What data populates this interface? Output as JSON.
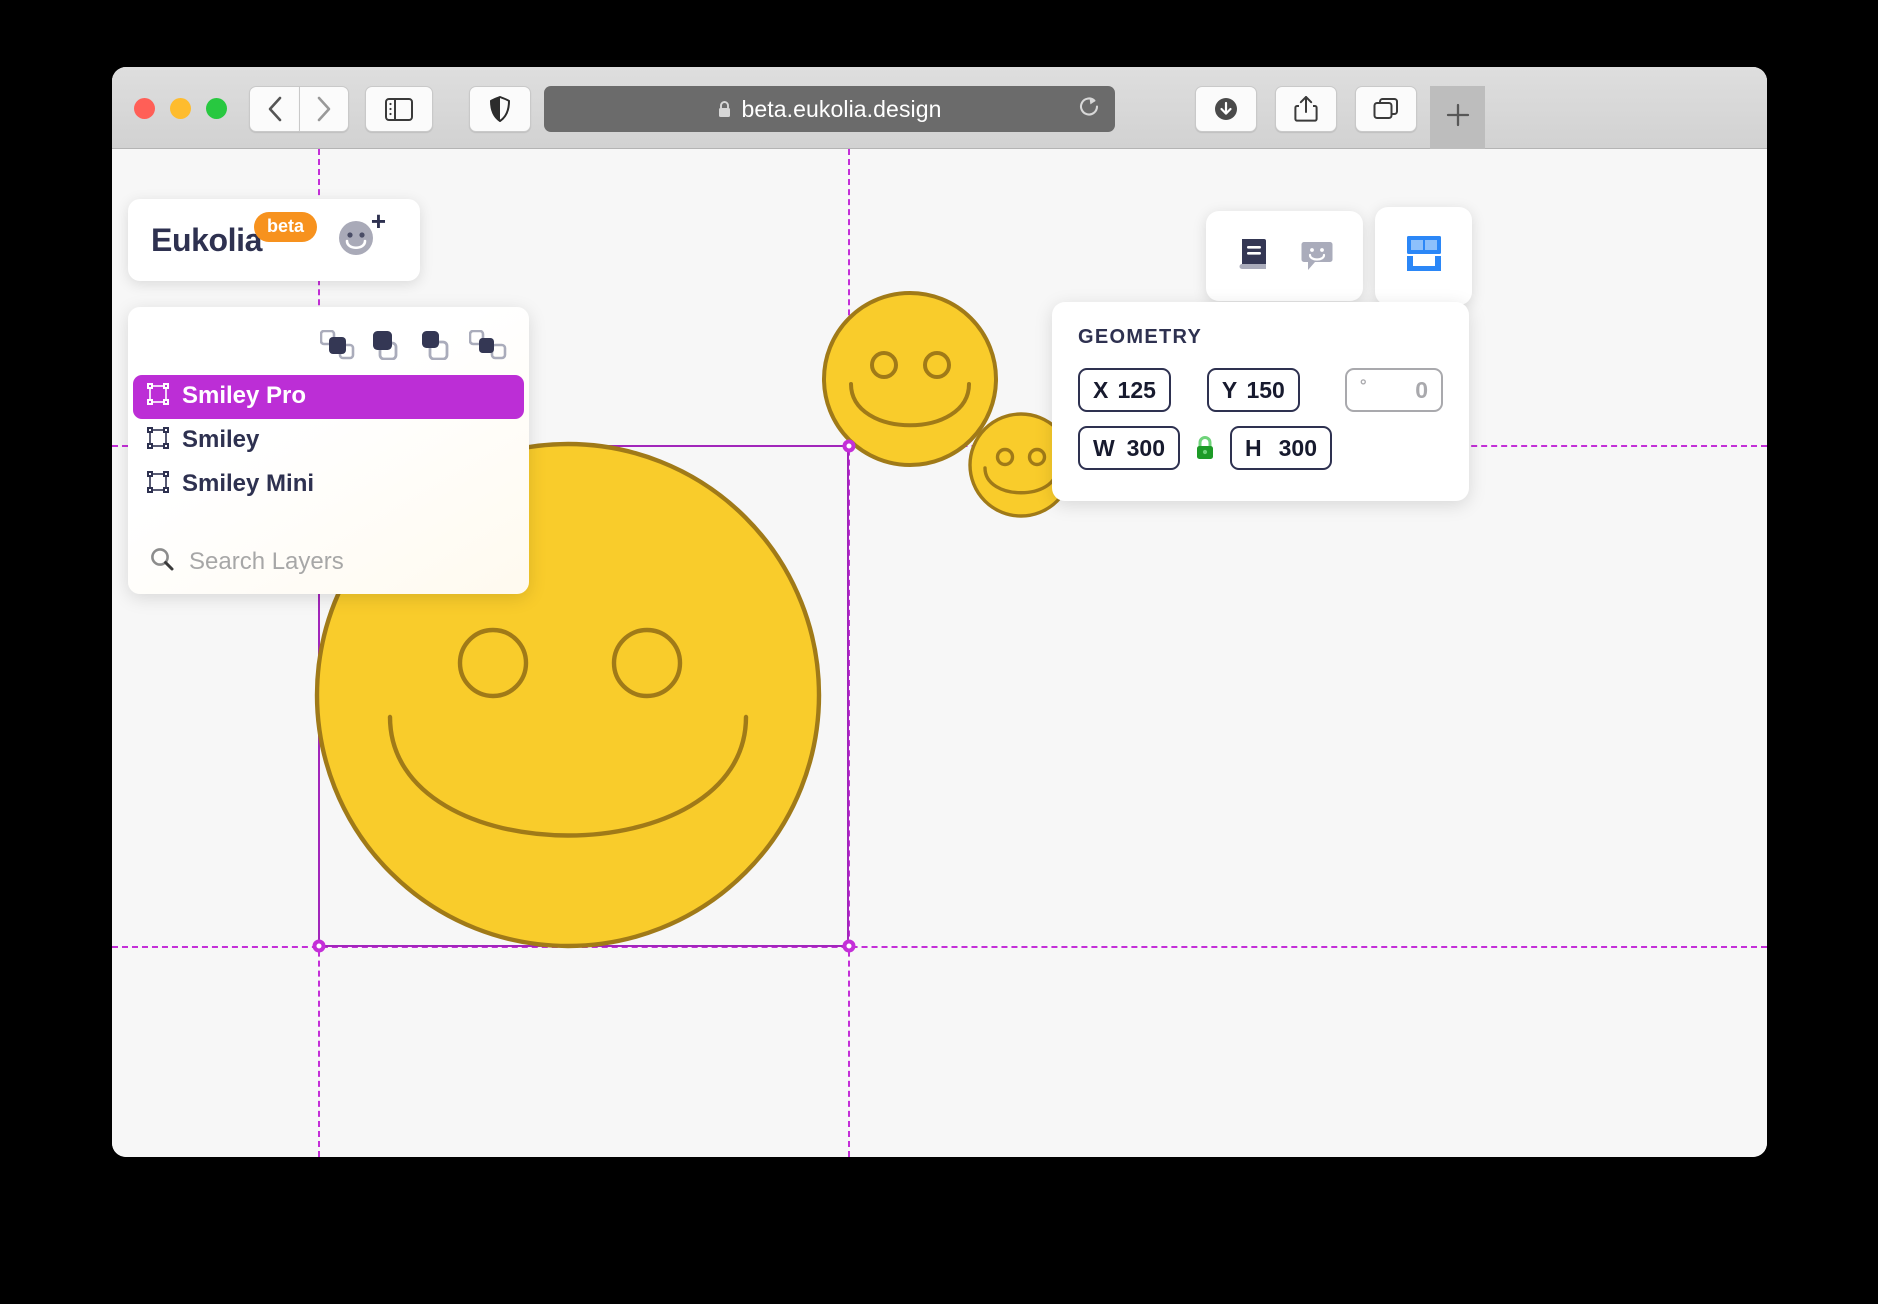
{
  "browser": {
    "address": "beta.eukolia.design",
    "lock_icon": "lock-icon",
    "reload_icon": "reload-icon",
    "back_icon": "chevron-left-icon",
    "forward_icon": "chevron-right-icon",
    "sidebar_icon": "sidebar-icon",
    "shield_icon": "shield-icon",
    "download_icon": "download-icon",
    "share_icon": "share-icon",
    "tabs_icon": "tab-overview-icon",
    "newtab_label": "+"
  },
  "app": {
    "logo_text": "Eukolia",
    "beta_badge": "beta",
    "avatar_icon": "smiley-avatar-icon",
    "avatar_plus": "+"
  },
  "layers_panel": {
    "arrange_buttons": [
      {
        "name": "send-to-back-button",
        "icon": "send-to-back-icon"
      },
      {
        "name": "bring-to-front-button",
        "icon": "bring-to-front-icon"
      },
      {
        "name": "bring-forward-button",
        "icon": "bring-forward-icon"
      },
      {
        "name": "send-backward-button",
        "icon": "send-backward-icon"
      }
    ],
    "items": [
      {
        "label": "Smiley Pro",
        "selected": true
      },
      {
        "label": "Smiley",
        "selected": false
      },
      {
        "label": "Smiley Mini",
        "selected": false
      }
    ],
    "search": {
      "placeholder": "Search Layers",
      "value": "",
      "icon": "search-icon"
    },
    "selected_color": "#bc2ed6"
  },
  "toolbar": {
    "left_card": [
      {
        "name": "library-button",
        "icon": "book-icon"
      },
      {
        "name": "comments-button",
        "icon": "smiley-comment-icon"
      }
    ],
    "right_card": [
      {
        "name": "layout-button",
        "icon": "layout-panels-icon"
      }
    ],
    "accent_blue": "#2b87f7"
  },
  "geometry": {
    "title": "GEOMETRY",
    "fields": [
      {
        "key": "X",
        "value": "125",
        "name": "x-field",
        "muted": false
      },
      {
        "key": "Y",
        "value": "150",
        "name": "y-field",
        "muted": false
      },
      {
        "key": "°",
        "value": "0",
        "name": "rotation-field",
        "muted": true
      },
      {
        "key": "W",
        "value": "300",
        "name": "width-field",
        "muted": false
      },
      {
        "key": "H",
        "value": "300",
        "name": "height-field",
        "muted": false
      }
    ],
    "lock": {
      "name": "aspect-lock-toggle",
      "icon": "lock-closed-icon",
      "color": "#1d9b27",
      "state": "locked"
    }
  },
  "canvas": {
    "background": "#f7f7f7",
    "selection_color": "#c42fd8",
    "shape_fill": "#f9cc2b",
    "shape_stroke": "#a07a18",
    "shapes": [
      {
        "name": "smiley-pro",
        "label": "Smiley Pro",
        "size": 300
      },
      {
        "name": "smiley",
        "label": "Smiley",
        "size": 115
      },
      {
        "name": "smiley-mini",
        "label": "Smiley Mini",
        "size": 60
      }
    ]
  }
}
